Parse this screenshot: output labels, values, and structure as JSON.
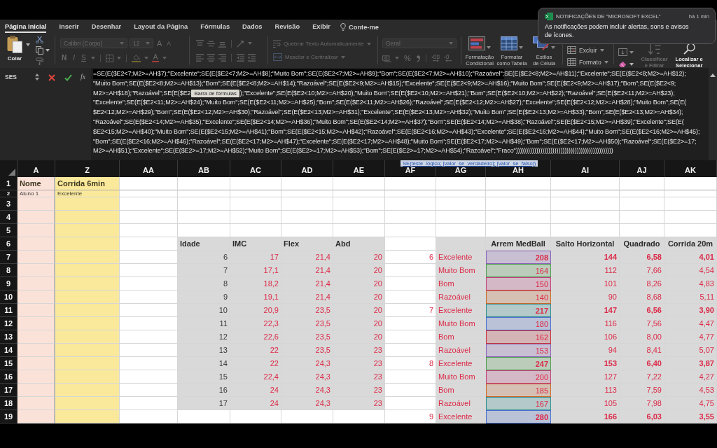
{
  "notification": {
    "app": "NOTIFICAÇÕES DE \"MICROSOFT EXCEL\"",
    "time": "há 1 min",
    "message": "As notificações podem incluir alertas, sons e avisos de ícones."
  },
  "tabs": [
    {
      "label": "Página Inicial",
      "selected": true
    },
    {
      "label": "Inserir",
      "selected": false
    },
    {
      "label": "Desenhar",
      "selected": false
    },
    {
      "label": "Layout da Página",
      "selected": false
    },
    {
      "label": "Fórmulas",
      "selected": false
    },
    {
      "label": "Dados",
      "selected": false
    },
    {
      "label": "Revisão",
      "selected": false
    },
    {
      "label": "Exibir",
      "selected": false
    }
  ],
  "tell_me": "Conte-me",
  "ribbon": {
    "paste": {
      "label": "Colar",
      "disabled": false
    },
    "font": {
      "family": "Calibri (Corpo)",
      "size": "12",
      "grow": "A",
      "shrink": "A",
      "bold": "N",
      "italic": "I",
      "underline": "S",
      "font_color_label": "A",
      "disabled": true
    },
    "alignment": {
      "wrap_text": "Quebrar Texto Automaticamente",
      "merge": "Mesclar e Centralizar",
      "disabled": true
    },
    "number": {
      "format": "Geral",
      "percent": "%",
      "disabled": true
    },
    "styles": [
      {
        "label": "Formatação\nCondicional",
        "disabled": false
      },
      {
        "label": "Formatar\ncomo Tabela",
        "disabled": false
      },
      {
        "label": "Estilos\nde Célula",
        "disabled": false
      }
    ],
    "cells": [
      {
        "label": "Excluir",
        "disabled": false
      },
      {
        "label": "Formato",
        "disabled": false
      }
    ],
    "editing": [
      {
        "label": "Classificar\ne Filtrar",
        "disabled": true
      },
      {
        "label": "Localizar e\nSelecionar",
        "disabled": false
      }
    ]
  },
  "formula_bar": {
    "name_box": "SES",
    "function_button": "fx",
    "lines": [
      {
        "parts": [
          {
            "kind": "selected",
            "text": "=SE(E($E2<7;M2>=AH$7);\"Excelente\";SE(E($E2<7;M2>=AH$8);\"Muito Bom\";SE(E($E2<7;M2>=AH$9);\"Bom\";SE(E($E2<7;M2>=AH$10);\"Razoável\";"
          },
          {
            "kind": "text",
            "text": "SE(E($E2<8;M2>=AH$11);\"Excelente\";SE(E($E2<8;M2>=AH$12);"
          }
        ]
      },
      {
        "parts": [
          {
            "kind": "text",
            "text": "\"Muito Bom\";SE(E($E2<8;M2>=AH$13);\"Bom\";SE(E($E2<8;M2>=AH$14);\"Razoável\";SE(E($E2<9;M2>=AH$15);\"Excelente\";SE(E($E2<9;M2>=AH$16);\"Muito Bom\";SE(E($E2<9;M2>=AH$17);\"Bom\";SE(E($E2<9;"
          }
        ]
      },
      {
        "parts": [
          {
            "kind": "text",
            "text": "M2>=AH$18);\"Razoável\";SE(E($E2"
          },
          {
            "kind": "tooltip",
            "text": "Barra de fórmulas"
          },
          {
            "kind": "text",
            "text": ");\"Excelente\";SE(E($E2<10;M2>=AH$20);\"Muito Bom\";SE(E($E2<10;M2>=AH$21);\"Bom\";SE(E($E2<10;M2>=AH$22);\"Razoável\";SE(E($E2<11;M2>=AH$23);"
          }
        ]
      },
      {
        "parts": [
          {
            "kind": "text",
            "text": "\"Excelente\";SE(E($E2<11;M2>=AH$24);\"Muito Bom\";SE(E($E2<11;M2>=AH$25);\"Bom\";SE(E($E2<11;M2>=AH$26);\"Razoável\";SE(E($E2<12;M2>=AH$27);\"Excelente\";SE(E($E2<12;M2>=AH$28);\"Muito Bom\";SE(E("
          }
        ]
      },
      {
        "parts": [
          {
            "kind": "text",
            "text": "$E2<12;M2>=AH$29);\"Bom\";SE(E($E2<12;M2>=AH$30);\"Razoável\";SE(E($E2<13;M2>=AH$31);\"Excelente\";SE(E($E2<13;M2>=AH$32);\"Muito Bom\";SE(E($E2<13;M2>=AH$33);\"Bom\";SE(E($E2<13;M2>=AH$34);"
          }
        ]
      },
      {
        "parts": [
          {
            "kind": "text",
            "text": "\"Razoável\";SE(E($E2<14;M2>=AH$35);\"Excelente\";SE(E($E2<14;M2>=AH$36);\"Muito Bom\";SE(E($E2<14;M2>=AH$37);\"Bom\";SE(E($E2<14;M2>=AH$38);\"Razoável\";SE(E($E2<15;M2>=AH$39);\"Excelente\";SE(E("
          }
        ]
      },
      {
        "parts": [
          {
            "kind": "text",
            "text": "$E2<15;M2>=AH$40);\"Muito Bom\";SE(E($E2<15;M2>=AH$41);\"Bom\";SE(E($E2<15;M2>=AH$42);\"Razoável\";SE(E($E2<16;M2>=AH$43);\"Excelente\";SE(E($E2<16;M2>=AH$44);\"Muito Bom\";SE(E($E2<16;M2>=AH$45);"
          }
        ]
      },
      {
        "parts": [
          {
            "kind": "text",
            "text": "\"Bom\";SE(E($E2<16;M2>=AH$46);\"Razoável\";SE(E($E2<17;M2>=AH$47);\"Excelente\";SE(E($E2<17;M2>=AH$48);\"Muito Bom\";SE(E($E2<17;M2>=AH$49);\"Bom\";SE(E($E2<17;M2>=AH$50);\"Razoável\";SE(E($E2>=17;"
          }
        ]
      },
      {
        "parts": [
          {
            "kind": "text",
            "text": "M2>=AH$51);\"Excelente\";SE(E($E2>=17;M2>=AH$52);\"Muito Bom\";SE(E($E2>=17;M2>=AH$53);\"Bom\";SE(E($E2>=17;M2>=AH$54);\"Razoável\";\"Fraco\"))))))))))))))))))))))))))))))))))))))))))))))))"
          }
        ]
      }
    ]
  },
  "sheet": {
    "function_hint": "SE(teste_lógico; [valor_se_verdadeiro]; [valor_se_falso])",
    "columns": [
      "A",
      "Z",
      "AA",
      "AB",
      "AC",
      "AD",
      "AE",
      "AF",
      "AG",
      "AH",
      "AI",
      "AJ",
      "AK"
    ],
    "row_headers": [
      "1",
      "2",
      "3",
      "4",
      "5",
      "6",
      "7",
      "8",
      "9",
      "10",
      "11",
      "12",
      "13",
      "14",
      "15",
      "16",
      "17",
      "18",
      "19"
    ],
    "student": {
      "headers": [
        "Nome",
        "Corrida 6min"
      ],
      "first_row": [
        "Aluno 1",
        "Excelente"
      ]
    },
    "reference_table": {
      "headers": [
        "Idade",
        "IMC",
        "Flex",
        "Abd"
      ],
      "rows": [
        [
          "6",
          "17",
          "21,4",
          "20"
        ],
        [
          "7",
          "17,1",
          "21,4",
          "20"
        ],
        [
          "8",
          "18,2",
          "21,4",
          "20"
        ],
        [
          "9",
          "19,1",
          "21,4",
          "20"
        ],
        [
          "10",
          "20,9",
          "23,5",
          "20"
        ],
        [
          "11",
          "22,3",
          "23,5",
          "20"
        ],
        [
          "12",
          "22,6",
          "23,5",
          "20"
        ],
        [
          "13",
          "22",
          "23,5",
          "23"
        ],
        [
          "14",
          "22",
          "24,3",
          "23"
        ],
        [
          "15",
          "22,4",
          "24,3",
          "23"
        ],
        [
          "16",
          "24",
          "24,3",
          "23"
        ],
        [
          "17",
          "24",
          "24,3",
          "23"
        ]
      ]
    },
    "grade_table": {
      "headers": [
        "Arrem MedBall",
        "Salto Horizontal",
        "Quadrado",
        "Corrida 20m"
      ],
      "rows": [
        {
          "age": "6",
          "grade": "Excelente",
          "medball": "208",
          "color": "#8a62b8",
          "jump": "144",
          "square": "6,58",
          "run": "4,01",
          "bold": true
        },
        {
          "grade": "Muito Bom",
          "medball": "164",
          "color": "#4f9d4f",
          "jump": "112",
          "square": "7,66",
          "run": "4,54",
          "bold": false
        },
        {
          "grade": "Bom",
          "medball": "150",
          "color": "#c2417e",
          "jump": "101",
          "square": "8,26",
          "run": "4,83",
          "bold": false
        },
        {
          "grade": "Razoável",
          "medball": "140",
          "color": "#c8682a",
          "jump": "90",
          "square": "8,68",
          "run": "5,11",
          "bold": false
        },
        {
          "age": "7",
          "grade": "Excelente",
          "medball": "217",
          "color": "#2f8f8f",
          "jump": "147",
          "square": "6,56",
          "run": "3,90",
          "bold": true
        },
        {
          "grade": "Muito Bom",
          "medball": "180",
          "color": "#4a6fd0",
          "jump": "116",
          "square": "7,56",
          "run": "4,47",
          "bold": false
        },
        {
          "grade": "Bom",
          "medball": "162",
          "color": "#c8323c",
          "jump": "106",
          "square": "8,00",
          "run": "4,77",
          "bold": false
        },
        {
          "grade": "Razoável",
          "medball": "153",
          "color": "#8a62b8",
          "jump": "94",
          "square": "8,41",
          "run": "5,07",
          "bold": false
        },
        {
          "age": "8",
          "grade": "Excelente",
          "medball": "247",
          "color": "#4f9d4f",
          "jump": "153",
          "square": "6,40",
          "run": "3,87",
          "bold": true
        },
        {
          "grade": "Muito Bom",
          "medball": "200",
          "color": "#c2417e",
          "jump": "127",
          "square": "7,22",
          "run": "4,27",
          "bold": false
        },
        {
          "grade": "Bom",
          "medball": "185",
          "color": "#c8682a",
          "jump": "113",
          "square": "7,59",
          "run": "4,53",
          "bold": false
        },
        {
          "grade": "Razoável",
          "medball": "167",
          "color": "#2f8f8f",
          "jump": "105",
          "square": "7,98",
          "run": "4,75",
          "bold": false
        },
        {
          "age": "9",
          "grade": "Excelente",
          "medball": "280",
          "color": "#4a6fd0",
          "jump": "166",
          "square": "6,03",
          "run": "3,55",
          "bold": true
        }
      ]
    }
  }
}
